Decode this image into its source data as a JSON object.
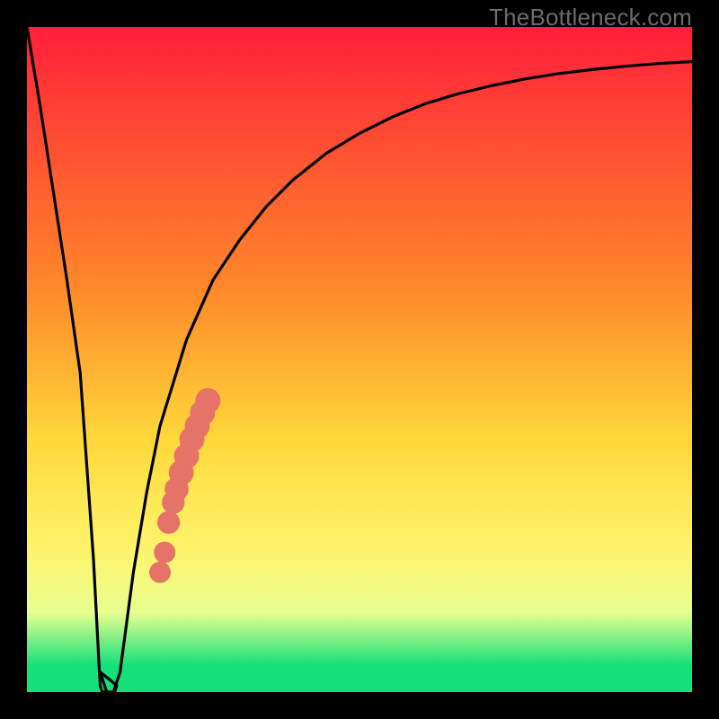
{
  "watermark": "TheBottleneck.com",
  "colors": {
    "top": "#ff1f3a",
    "mid_upper": "#ff8a2a",
    "mid": "#ffd83a",
    "mid_lower": "#fff36a",
    "low_band": "#e9ff90",
    "bottom": "#15e07a",
    "curve": "#000000",
    "dots": "#e57368",
    "frame": "#000000"
  },
  "chart_data": {
    "type": "line",
    "title": "",
    "xlabel": "",
    "ylabel": "",
    "xlim": [
      0,
      100
    ],
    "ylim": [
      0,
      100
    ],
    "series": [
      {
        "name": "bottleneck-curve",
        "x": [
          0,
          2,
          4,
          6,
          8,
          10,
          11,
          12,
          13,
          14,
          16,
          18,
          20,
          24,
          28,
          32,
          36,
          40,
          45,
          50,
          55,
          60,
          65,
          70,
          75,
          80,
          85,
          90,
          95,
          100
        ],
        "y": [
          100,
          88,
          75,
          62,
          48,
          20,
          3,
          0,
          0,
          3,
          18,
          30,
          40,
          53,
          62,
          68,
          73,
          77,
          81,
          84,
          86.5,
          88.5,
          90,
          91.2,
          92.2,
          93,
          93.6,
          94.1,
          94.5,
          94.8
        ]
      }
    ],
    "flat_bottom": {
      "x_start": 11,
      "x_end": 13.5,
      "y": 0
    },
    "dot_overlay": {
      "name": "highlight-dots",
      "points": [
        {
          "x": 20.0,
          "y": 18.0,
          "r": 1.2
        },
        {
          "x": 20.7,
          "y": 21.0,
          "r": 1.2
        },
        {
          "x": 21.3,
          "y": 25.5,
          "r": 1.3
        },
        {
          "x": 22.0,
          "y": 28.5,
          "r": 1.3
        },
        {
          "x": 22.5,
          "y": 30.5,
          "r": 1.4
        },
        {
          "x": 23.2,
          "y": 33.0,
          "r": 1.5
        },
        {
          "x": 24.0,
          "y": 35.5,
          "r": 1.5
        },
        {
          "x": 24.8,
          "y": 38.0,
          "r": 1.5
        },
        {
          "x": 25.6,
          "y": 40.0,
          "r": 1.5
        },
        {
          "x": 26.4,
          "y": 42.0,
          "r": 1.5
        },
        {
          "x": 27.2,
          "y": 43.8,
          "r": 1.5
        }
      ]
    },
    "gradient_stops": [
      {
        "pct": 0,
        "key": "top"
      },
      {
        "pct": 40,
        "key": "mid_upper"
      },
      {
        "pct": 62,
        "key": "mid"
      },
      {
        "pct": 78,
        "key": "mid_lower"
      },
      {
        "pct": 88,
        "key": "low_band"
      },
      {
        "pct": 96,
        "key": "bottom"
      },
      {
        "pct": 100,
        "key": "bottom"
      }
    ]
  }
}
